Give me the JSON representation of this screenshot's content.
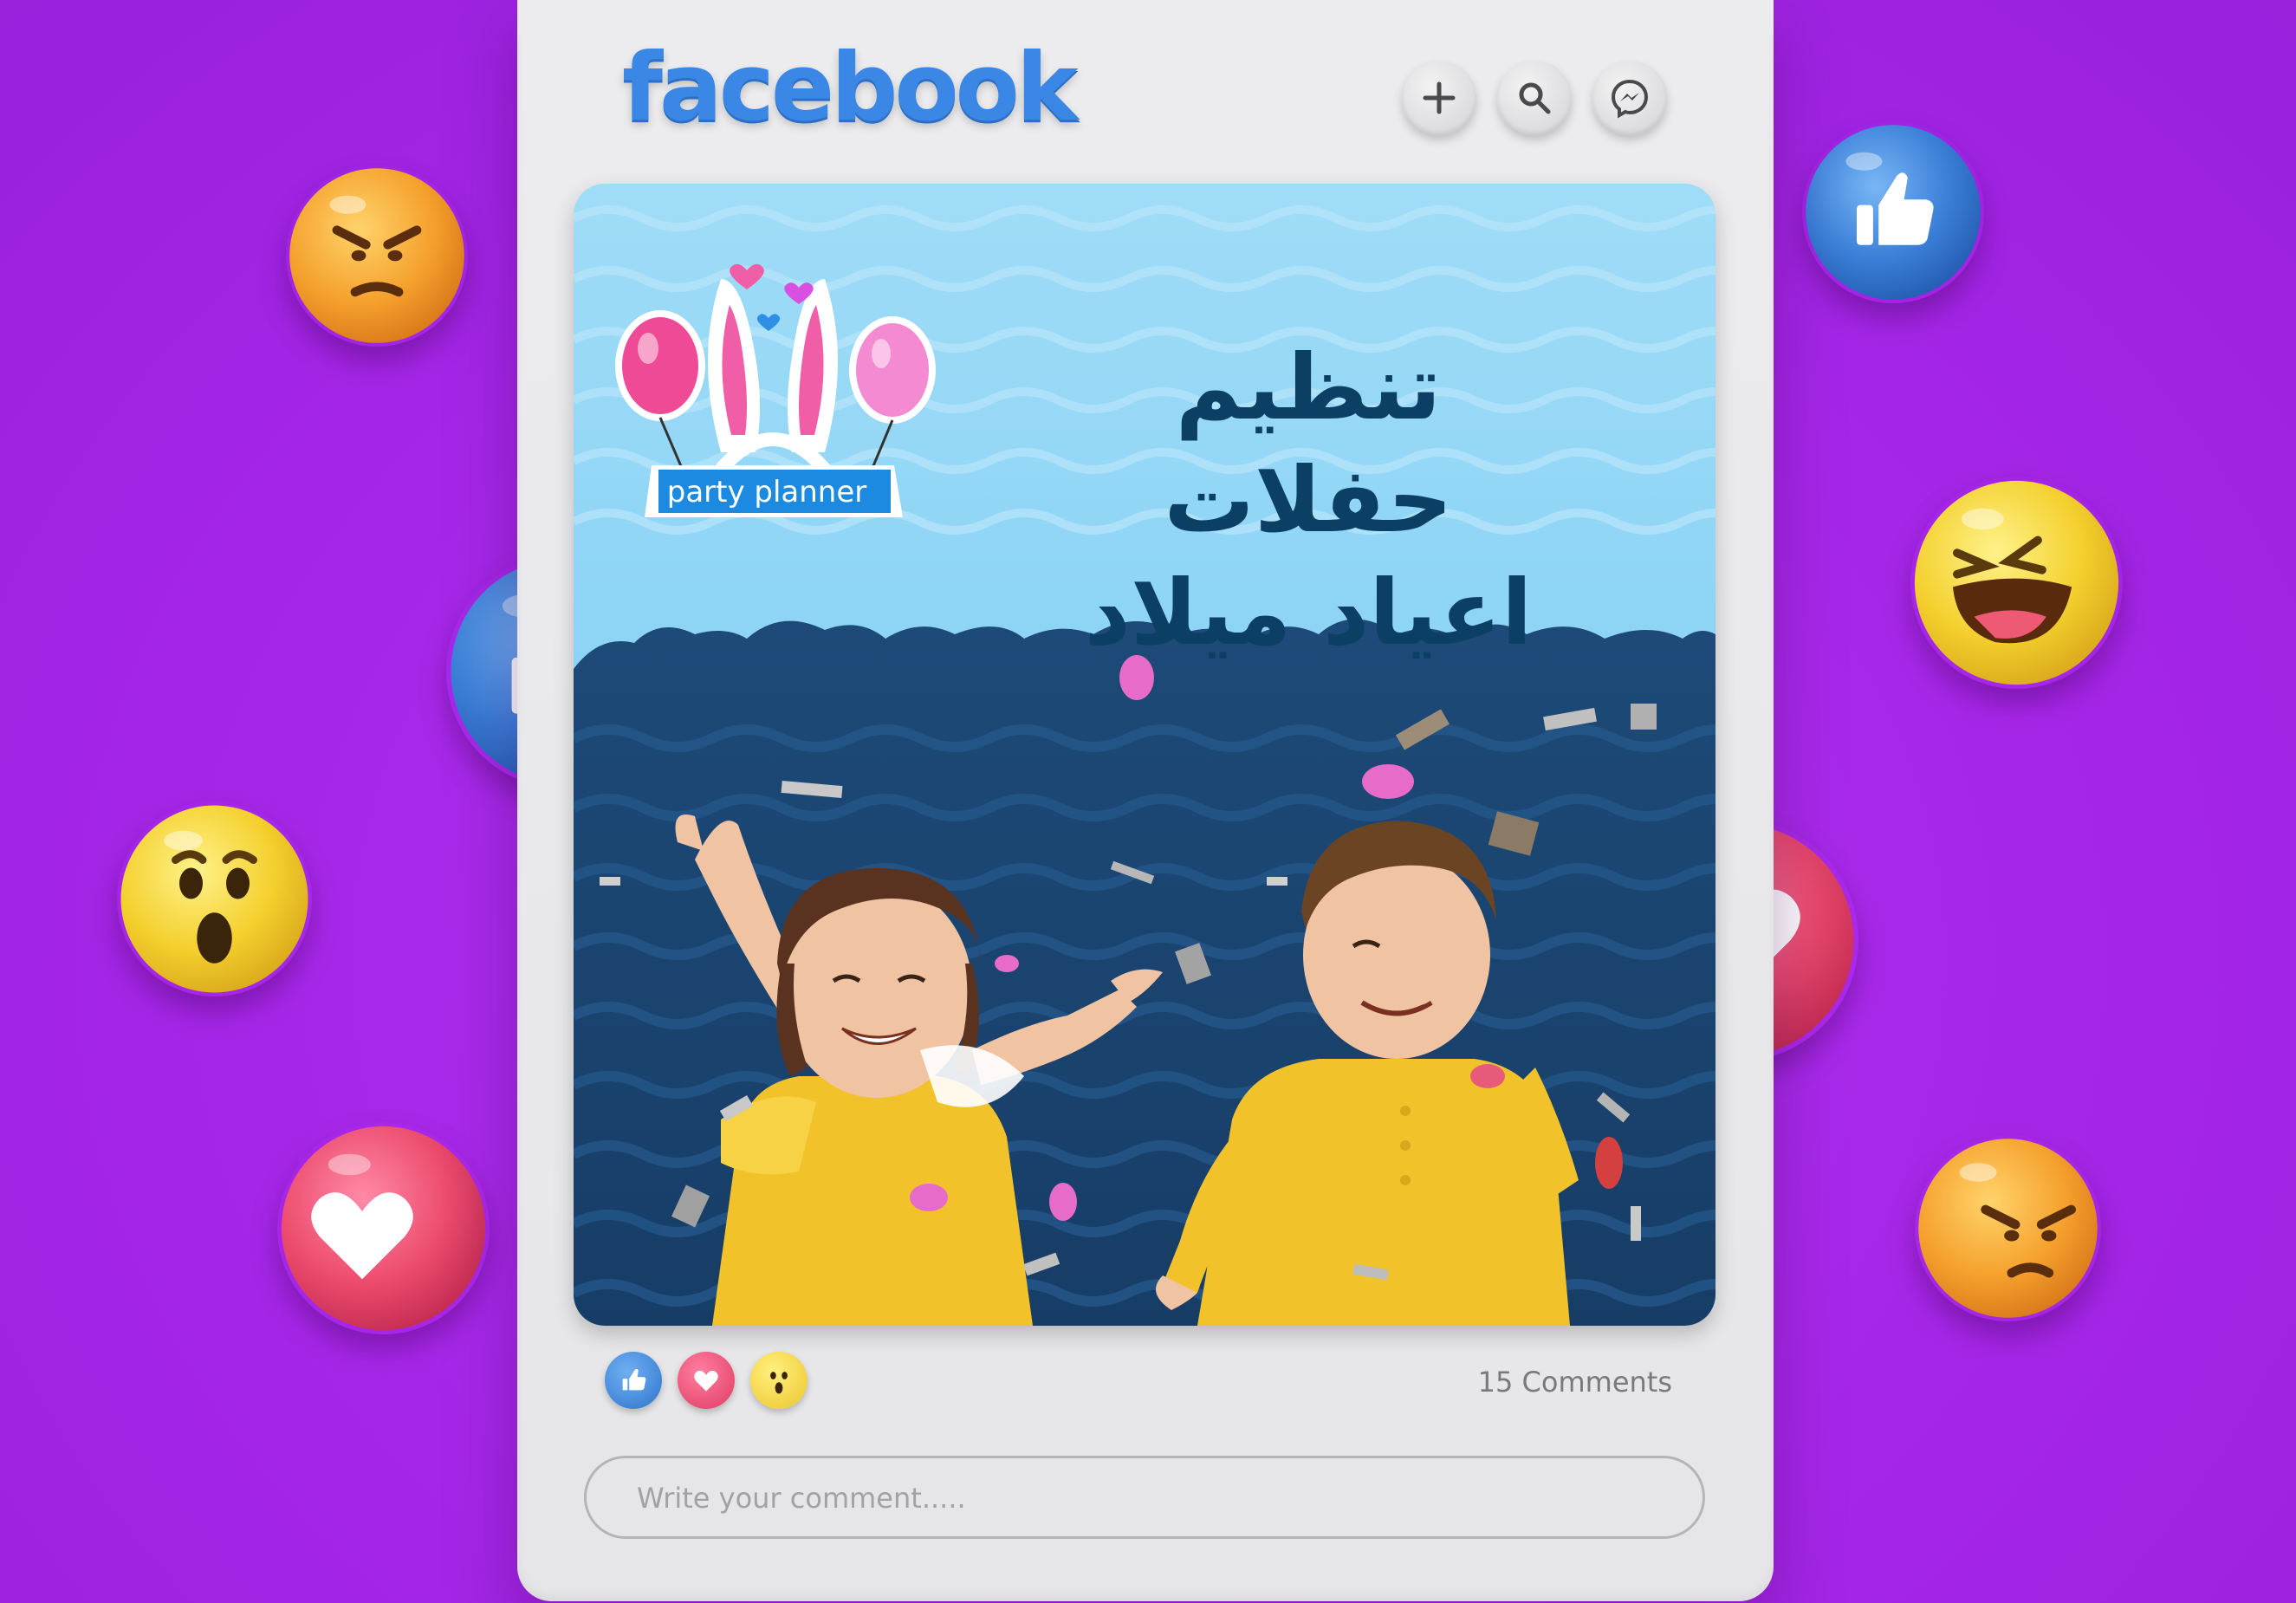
{
  "app": {
    "logo_text": "facebook",
    "brand_color": "#3b87e6",
    "background_color": "#a826ea"
  },
  "header": {
    "buttons": [
      {
        "name": "create-button",
        "icon": "plus-icon"
      },
      {
        "name": "search-button",
        "icon": "search-icon"
      },
      {
        "name": "messenger-button",
        "icon": "messenger-icon"
      }
    ]
  },
  "post": {
    "brand_label": "party planner",
    "headline_line1": "تنظيم حفلات",
    "headline_line2": "اعياد ميلاد",
    "headline_color": "#0b3f63"
  },
  "footer": {
    "reactions": [
      "like-icon",
      "love-icon",
      "wow-icon"
    ],
    "comments_count": "15 Comments"
  },
  "comment": {
    "placeholder": "Write your comment.....",
    "value": ""
  },
  "floating_reactions": [
    "angry-icon",
    "like-icon",
    "haha-icon",
    "like-icon",
    "wow-icon",
    "love-icon",
    "love-icon",
    "angry-icon"
  ]
}
